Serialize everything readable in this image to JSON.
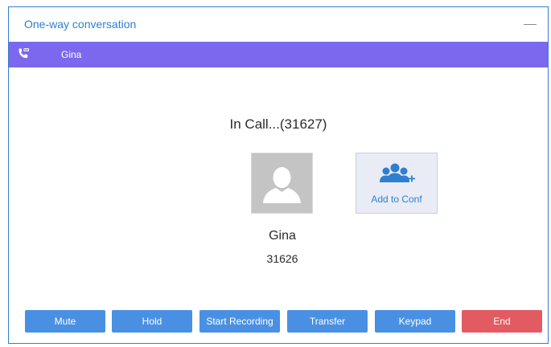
{
  "window": {
    "title": "One-way conversation"
  },
  "contact_bar": {
    "name": "Gina"
  },
  "call": {
    "status": "In Call...(31627)",
    "peer_name": "Gina",
    "peer_number": "31626"
  },
  "add_conf": {
    "label": "Add to Conf"
  },
  "buttons": {
    "mute": "Mute",
    "hold": "Hold",
    "start_recording": "Start Recording",
    "transfer": "Transfer",
    "keypad": "Keypad",
    "end": "End"
  },
  "colors": {
    "accent": "#2f7fd1",
    "contact_bar": "#7b68ee",
    "button_blue": "#4a90e2",
    "button_end": "#e25b62"
  }
}
